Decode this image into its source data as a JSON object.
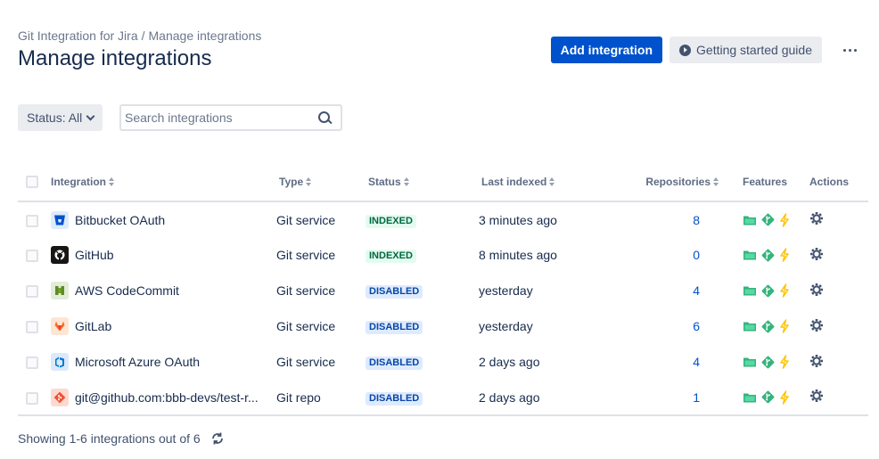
{
  "breadcrumb": {
    "root": "Git Integration for Jira",
    "separator": "/",
    "current": "Manage integrations"
  },
  "page_title": "Manage integrations",
  "toolbar": {
    "add_label": "Add integration",
    "guide_label": "Getting started guide",
    "more_icon": "more-icon"
  },
  "filters": {
    "status_label": "Status: All",
    "search_placeholder": "Search integrations"
  },
  "table": {
    "headers": {
      "integration": "Integration",
      "type": "Type",
      "status": "Status",
      "last_indexed": "Last indexed",
      "repositories": "Repositories",
      "features": "Features",
      "actions": "Actions"
    },
    "rows": [
      {
        "name": "Bitbucket OAuth",
        "icon": "bitbucket-icon",
        "type": "Git service",
        "status": "INDEXED",
        "last_indexed": "3 minutes ago",
        "repositories": "8"
      },
      {
        "name": "GitHub",
        "icon": "github-icon",
        "type": "Git service",
        "status": "INDEXED",
        "last_indexed": "8 minutes ago",
        "repositories": "0"
      },
      {
        "name": "AWS CodeCommit",
        "icon": "aws-codecommit-icon",
        "type": "Git service",
        "status": "DISABLED",
        "last_indexed": "yesterday",
        "repositories": "4"
      },
      {
        "name": "GitLab",
        "icon": "gitlab-icon",
        "type": "Git service",
        "status": "DISABLED",
        "last_indexed": "yesterday",
        "repositories": "6"
      },
      {
        "name": "Microsoft Azure OAuth",
        "icon": "azure-icon",
        "type": "Git service",
        "status": "DISABLED",
        "last_indexed": "2 days ago",
        "repositories": "4"
      },
      {
        "name": "git@github.com:bbb-devs/test-r...",
        "icon": "git-repo-icon",
        "type": "Git repo",
        "status": "DISABLED",
        "last_indexed": "2 days ago",
        "repositories": "1"
      }
    ]
  },
  "footer": {
    "summary": "Showing 1-6 integrations out of 6"
  },
  "colors": {
    "primary": "#0052cc",
    "indexed_bg": "#e3fcef",
    "indexed_text": "#006644",
    "disabled_bg": "#deebff",
    "disabled_text": "#0747a6",
    "feature_green": "#36b37e",
    "feature_yellow": "#ffc400"
  }
}
